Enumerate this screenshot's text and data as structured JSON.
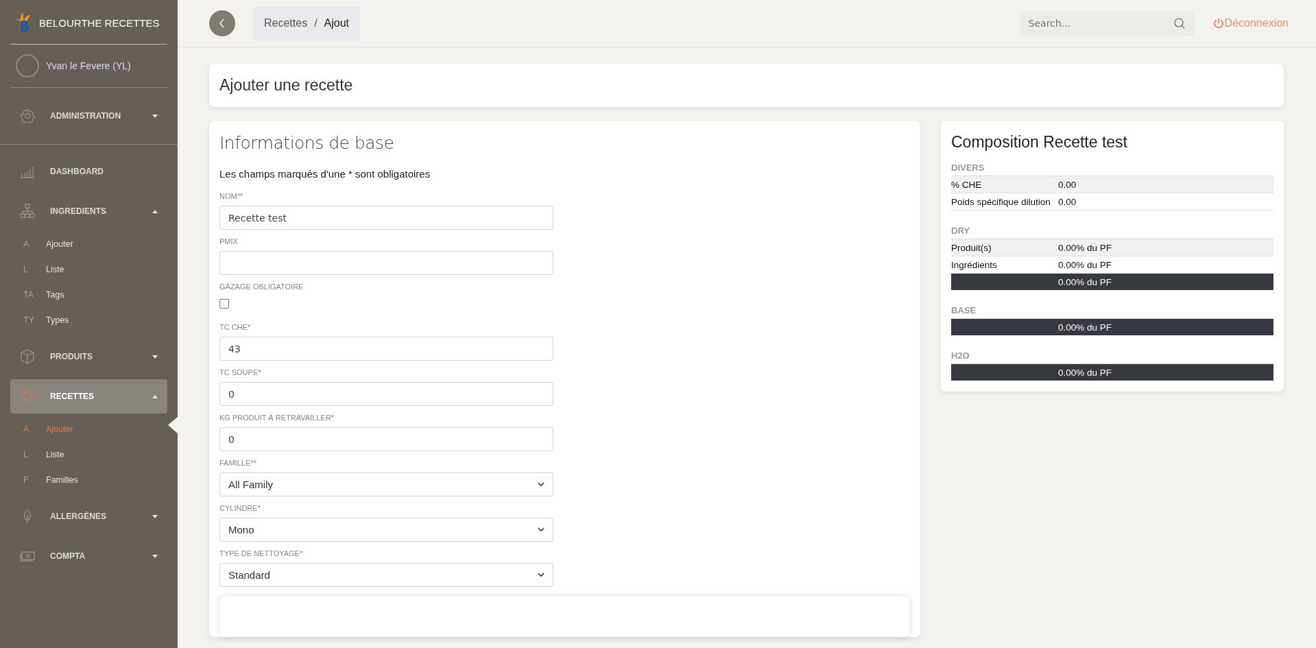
{
  "sidebar": {
    "brand": "BELOURTHE RECETTES",
    "user": "Yvan le Fevere (YL)",
    "items": [
      {
        "label": "ADMINISTRATION",
        "expanded": false,
        "selected": false,
        "divider_after": true
      },
      {
        "label": "DASHBOARD",
        "selected": false
      },
      {
        "label": "INGREDIENTS",
        "expanded": true,
        "selected": false,
        "children": [
          {
            "abbr": "A",
            "label": "Ajouter",
            "selected": false
          },
          {
            "abbr": "L",
            "label": "Liste",
            "selected": false
          },
          {
            "abbr": "TA",
            "label": "Tags",
            "selected": false
          },
          {
            "abbr": "TY",
            "label": "Types",
            "selected": false
          }
        ]
      },
      {
        "label": "PRODUITS",
        "expanded": false,
        "selected": false
      },
      {
        "label": "RECETTES",
        "expanded": true,
        "selected": true,
        "children": [
          {
            "abbr": "A",
            "label": "Ajouter",
            "selected": true
          },
          {
            "abbr": "L",
            "label": "Liste",
            "selected": false
          },
          {
            "abbr": "F",
            "label": "Familles",
            "selected": false
          }
        ]
      },
      {
        "label": "ALLERGÈNES",
        "expanded": false,
        "selected": false
      },
      {
        "label": "COMPTA",
        "expanded": false,
        "selected": false
      }
    ]
  },
  "header": {
    "breadcrumb": [
      "Recettes",
      "Ajout"
    ],
    "breadcrumb_separator": "/",
    "search": {
      "placeholder": "Search..."
    },
    "logout": "Déconnexion"
  },
  "page_title": "Ajouter une recette",
  "form": {
    "title": "Informations de base",
    "note": "Les champs marqués d'une * sont obligatoires",
    "fields": [
      {
        "kind": "text",
        "label": "NOM**",
        "value": "Recette test"
      },
      {
        "kind": "text",
        "label": "PMIX"
      },
      {
        "kind": "checkbox",
        "label": "GAZAGE OBLIGATOIRE",
        "checked": false
      },
      {
        "kind": "text",
        "label": "TC CHE*",
        "value": "43"
      },
      {
        "kind": "text",
        "label": "TC SOUPE*",
        "value": "0"
      },
      {
        "kind": "text",
        "label": "KG PRODUIT À RETRAVAILLER*",
        "value": "0"
      },
      {
        "kind": "select",
        "label": "FAMILLE**",
        "value": "All Family"
      },
      {
        "kind": "select",
        "label": "CYLINDRE*",
        "value": "Mono"
      },
      {
        "kind": "select",
        "label": "TYPE DE NETTOYAGE*",
        "value": "Standard"
      }
    ]
  },
  "composition": {
    "title": "Composition Recette test",
    "sections": [
      {
        "heading": "DIVERS",
        "rows": [
          {
            "kind": "row",
            "label": "% CHE",
            "value": "0.00"
          },
          {
            "kind": "row",
            "label": "Poids spécifique dilution",
            "value": "0.00"
          }
        ]
      },
      {
        "heading": "DRY",
        "rows": [
          {
            "kind": "row",
            "label": "Produit(s)",
            "value": "0.00% du PF"
          },
          {
            "kind": "row",
            "label": "Ingrédients",
            "value": "0.00% du PF"
          },
          {
            "kind": "total",
            "value": "0.00% du PF"
          }
        ]
      },
      {
        "heading": "BASE",
        "rows": [
          {
            "kind": "total",
            "value": "0.00% du PF"
          }
        ]
      },
      {
        "heading": "H2O",
        "rows": [
          {
            "kind": "total",
            "value": "0.00% du PF"
          }
        ]
      }
    ]
  }
}
